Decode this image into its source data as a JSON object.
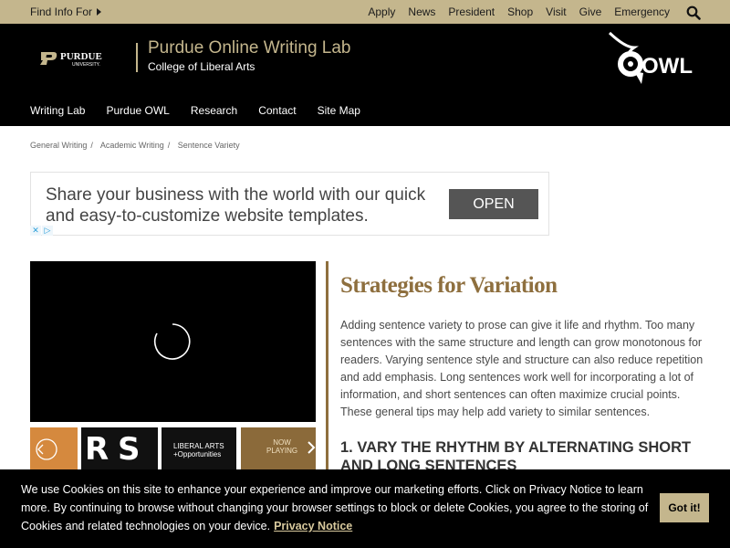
{
  "topbar": {
    "find_info": "Find Info For",
    "links": [
      "Apply",
      "News",
      "President",
      "Shop",
      "Visit",
      "Give",
      "Emergency"
    ]
  },
  "header": {
    "purdue_wordmark": "PURDUE",
    "purdue_sub": "UNIVERSITY.",
    "lab_title": "Purdue Online Writing Lab",
    "lab_subtitle": "College of Liberal Arts",
    "owl_logo_text": "OWL",
    "nav": [
      "Writing Lab",
      "Purdue OWL",
      "Research",
      "Contact",
      "Site Map"
    ]
  },
  "breadcrumb": [
    "General Writing",
    "Academic Writing",
    "Sentence Variety"
  ],
  "ad": {
    "text": "Share your business with the world with our quick and easy-to-customize website templates.",
    "button": "OPEN"
  },
  "video": {
    "thumbs": [
      {
        "kind": "orange"
      },
      {
        "kind": "rs",
        "text": "R S"
      },
      {
        "kind": "liberal-arts",
        "line1": "LIBERAL ARTS",
        "line2": "+Opportunities"
      },
      {
        "kind": "now-playing",
        "line1": "NOW",
        "line2": "PLAYING"
      }
    ]
  },
  "content": {
    "heading": "Strategies for Variation",
    "paragraph": "Adding sentence variety to prose can give it life and rhythm. Too many sentences with the same structure and length can grow monotonous for readers. Varying sentence style and structure can also reduce repetition and add emphasis. Long sentences work well for incorporating a lot of information, and short sentences can often maximize crucial points. These general tips may help add variety to similar sentences.",
    "subheading": "1. VARY THE RHYTHM BY ALTERNATING SHORT AND LONG SENTENCES"
  },
  "cookie": {
    "text": "We use Cookies on this site to enhance your experience and improve our marketing efforts. Click on Privacy Notice to learn more. By continuing to browse without changing your browser settings to block or delete Cookies, you agree to the storing of Cookies and related technologies on your device.",
    "link": "Privacy Notice",
    "button": "Got it!"
  },
  "colors": {
    "gold": "#c4b68d",
    "dark_gold": "#8e6f3e",
    "black": "#000000"
  }
}
